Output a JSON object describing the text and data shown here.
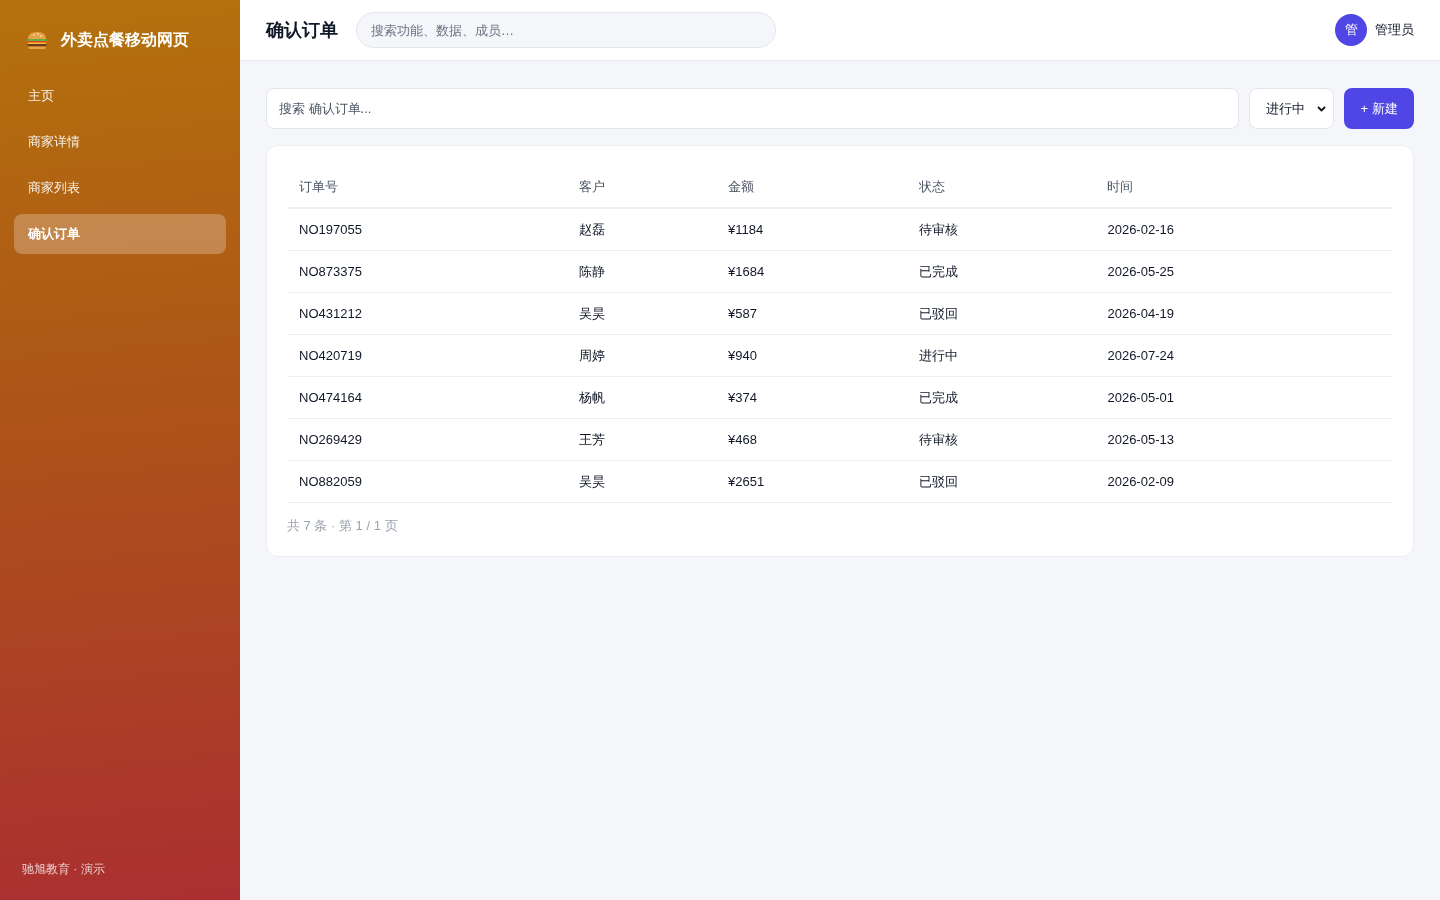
{
  "sidebar": {
    "brand": {
      "title": "外卖点餐移动网页"
    },
    "items": [
      {
        "label": "主页",
        "selected": false
      },
      {
        "label": "商家详情",
        "selected": false
      },
      {
        "label": "商家列表",
        "selected": false
      },
      {
        "label": "确认订单",
        "selected": true
      }
    ],
    "footer": "驰旭教育 · 演示"
  },
  "topbar": {
    "title": "确认订单",
    "search": {
      "placeholder": "搜索功能、数据、成员…"
    },
    "user": {
      "avatar": "管",
      "name": "管理员"
    }
  },
  "toolbar": {
    "search": {
      "placeholder": "搜索 确认订单..."
    },
    "filter": {
      "value": "进行中"
    },
    "new_button": "+ 新建"
  },
  "table": {
    "columns": [
      "订单号",
      "客户",
      "金额",
      "状态",
      "时间"
    ],
    "rows": [
      [
        "NO197055",
        "赵磊",
        "¥1184",
        "待审核",
        "2026-02-16"
      ],
      [
        "NO873375",
        "陈静",
        "¥1684",
        "已完成",
        "2026-05-25"
      ],
      [
        "NO431212",
        "吴昊",
        "¥587",
        "已驳回",
        "2026-04-19"
      ],
      [
        "NO420719",
        "周婷",
        "¥940",
        "进行中",
        "2026-07-24"
      ],
      [
        "NO474164",
        "杨帆",
        "¥374",
        "已完成",
        "2026-05-01"
      ],
      [
        "NO269429",
        "王芳",
        "¥468",
        "待审核",
        "2026-05-13"
      ],
      [
        "NO882059",
        "吴昊",
        "¥2651",
        "已驳回",
        "2026-02-09"
      ]
    ],
    "footer": "共 7 条 · 第 1 / 1 页"
  }
}
